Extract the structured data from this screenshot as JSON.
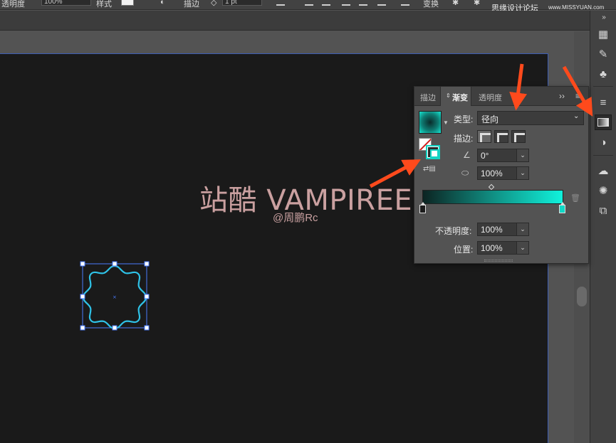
{
  "topbar": {
    "opacity_label": "透明度",
    "opacity_value": "100%",
    "style_label": "样式",
    "stroke_label": "描边",
    "stroke_weight": "1 pt",
    "transform_label": "变换"
  },
  "watermark": {
    "text": "思缘设计论坛",
    "url": "www.MISSYUAN.com"
  },
  "artboard": {
    "title": "站酷 VAMPIREE",
    "subtitle": "@周鹏Rc"
  },
  "panel": {
    "tabs": [
      {
        "label": "描边"
      },
      {
        "label": "渐变",
        "active": true
      },
      {
        "label": "透明度"
      }
    ],
    "type_label": "类型:",
    "type_value": "径向",
    "stroke_label": "描边:",
    "angle_value": "0°",
    "aspect_value": "100%",
    "opacity_label": "不透明度:",
    "opacity_value": "100%",
    "location_label": "位置:",
    "location_value": "100%",
    "gradient": {
      "type": "radial",
      "start_color": "#0c2422",
      "end_color": "#10f2dc"
    }
  },
  "colors": {
    "accent_arrow": "#ff4a1c",
    "shape_stroke": "#2fc3e8",
    "selection": "#4a7cff"
  },
  "dock": {
    "icons": [
      "libraries-icon",
      "brush-icon",
      "symbols-icon",
      "stroke-panel-icon",
      "gradient-panel-icon",
      "transparency-icon",
      "creative-cloud-icon",
      "appearance-icon",
      "artboards-icon"
    ]
  }
}
